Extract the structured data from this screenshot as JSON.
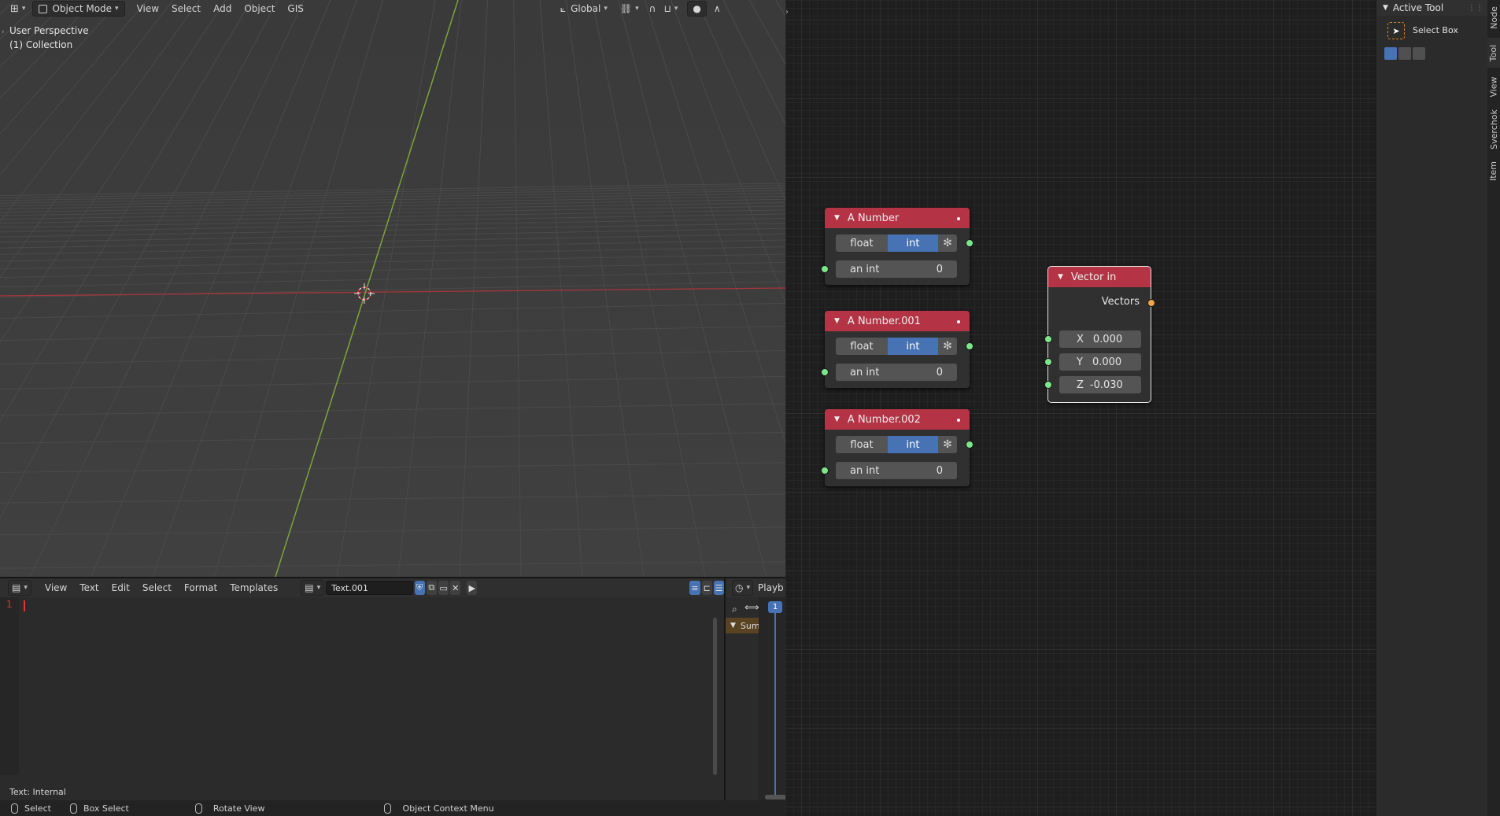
{
  "viewport": {
    "menu": [
      "View",
      "Select",
      "Add",
      "Object",
      "GIS"
    ],
    "mode": "Object Mode",
    "transform_orientation": "Global",
    "overlay_title": "User Perspective",
    "collection": "(1) Collection"
  },
  "text_editor": {
    "menu": [
      "View",
      "Text",
      "Edit",
      "Select",
      "Format",
      "Templates"
    ],
    "text_name": "Text.001",
    "line_number": "1",
    "status": "Text: Internal"
  },
  "timeline": {
    "menu_partial": "Playb",
    "channel_partial": "Sum",
    "current_frame": "1"
  },
  "nodes": [
    {
      "title": "A Number",
      "mode_float": "float",
      "mode_int": "int",
      "field_label": "an int",
      "field_value": "0"
    },
    {
      "title": "A Number.001",
      "mode_float": "float",
      "mode_int": "int",
      "field_label": "an int",
      "field_value": "0"
    },
    {
      "title": "A Number.002",
      "mode_float": "float",
      "mode_int": "int",
      "field_label": "an int",
      "field_value": "0"
    }
  ],
  "vector_node": {
    "title": "Vector in",
    "output_label": "Vectors",
    "x_label": "X",
    "x_value": "0.000",
    "y_label": "Y",
    "y_value": "0.000",
    "z_label": "Z",
    "z_value": "-0.030"
  },
  "sidebar": {
    "panel_title": "Active Tool",
    "tool_name": "Select Box",
    "tabs": [
      "Node",
      "Tool",
      "View",
      "Sverchok",
      "Item"
    ]
  },
  "statusbar": {
    "items": [
      "Select",
      "Box Select",
      "Rotate View",
      "Object Context Menu"
    ]
  },
  "colors": {
    "node_header": "#b43344",
    "accent_blue": "#4772b3",
    "socket_green": "#7ee68a",
    "socket_orange": "#f0a64a",
    "x_axis": "#c0393b",
    "y_axis": "#7ea33a"
  }
}
